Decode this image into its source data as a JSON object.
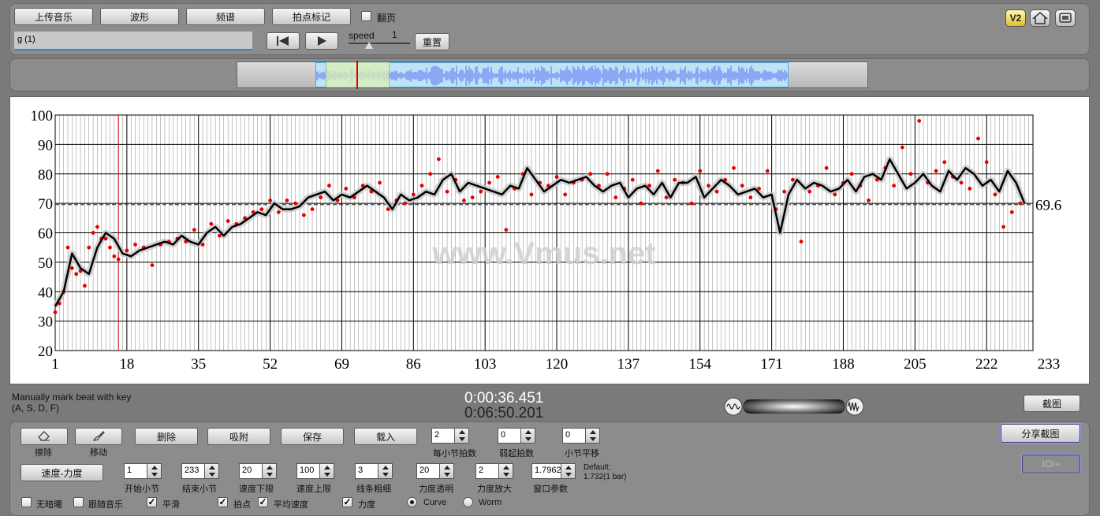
{
  "top": {
    "upload_label": "上传音乐",
    "wave_label": "波形",
    "spectrum_label": "频谱",
    "beat_mark_label": "拍点标记",
    "flip_label": "翻页",
    "file_name": "g (1)",
    "speed_label": "speed",
    "speed_value": "1",
    "reset_label": "重置",
    "version_badge": "V2",
    "home_icon": "home-icon",
    "window_icon": "window-icon"
  },
  "chart_data": {
    "type": "line",
    "watermark": "www.Vmus.net",
    "ylim": [
      20,
      100
    ],
    "yticks": [
      20,
      30,
      40,
      50,
      60,
      70,
      80,
      90,
      100
    ],
    "xlim": [
      1,
      233
    ],
    "xticks": [
      1,
      18,
      35,
      52,
      69,
      86,
      103,
      120,
      137,
      154,
      171,
      188,
      205,
      222,
      233
    ],
    "mean": 69.6,
    "mean_label": "69.6",
    "cursor_x": 16,
    "smooth_series": {
      "color": "#000000",
      "x": [
        1,
        3,
        5,
        7,
        9,
        11,
        13,
        15,
        17,
        19,
        21,
        23,
        25,
        27,
        29,
        31,
        33,
        35,
        37,
        39,
        41,
        43,
        45,
        47,
        49,
        51,
        53,
        55,
        57,
        59,
        61,
        63,
        65,
        67,
        69,
        71,
        73,
        75,
        77,
        79,
        81,
        83,
        85,
        87,
        89,
        91,
        93,
        95,
        97,
        99,
        101,
        103,
        105,
        107,
        109,
        111,
        113,
        115,
        117,
        119,
        121,
        123,
        125,
        127,
        129,
        131,
        133,
        135,
        137,
        139,
        141,
        143,
        145,
        147,
        149,
        151,
        153,
        155,
        157,
        159,
        161,
        163,
        165,
        167,
        169,
        171,
        173,
        175,
        177,
        179,
        181,
        183,
        185,
        187,
        189,
        191,
        193,
        195,
        197,
        199,
        201,
        203,
        205,
        207,
        209,
        211,
        213,
        215,
        217,
        219,
        221,
        223,
        225,
        227,
        229,
        231
      ],
      "y": [
        35,
        40,
        53,
        48,
        46,
        55,
        60,
        58,
        53,
        52,
        54,
        55,
        56,
        57,
        56,
        59,
        57,
        56,
        60,
        62,
        59,
        62,
        63,
        65,
        67,
        66,
        70,
        68,
        68,
        69,
        72,
        73,
        74,
        71,
        73,
        72,
        74,
        76,
        74,
        72,
        68,
        73,
        71,
        72,
        74,
        73,
        78,
        80,
        74,
        77,
        76,
        75,
        74,
        73,
        76,
        75,
        82,
        78,
        74,
        76,
        78,
        77,
        78,
        79,
        76,
        74,
        76,
        77,
        72,
        75,
        76,
        73,
        77,
        72,
        77,
        77,
        79,
        72,
        75,
        78,
        76,
        73,
        74,
        75,
        72,
        73,
        60,
        73,
        78,
        75,
        77,
        76,
        74,
        75,
        78,
        74,
        79,
        80,
        78,
        85,
        80,
        75,
        77,
        80,
        76,
        74,
        81,
        78,
        82,
        80,
        76,
        78,
        74,
        81,
        77,
        70,
        63,
        72
      ]
    },
    "scatter_series": {
      "color": "#e60000",
      "x": [
        1,
        2,
        3,
        4,
        5,
        6,
        7,
        8,
        9,
        10,
        11,
        12,
        13,
        14,
        15,
        16,
        18,
        20,
        22,
        24,
        26,
        28,
        30,
        32,
        34,
        36,
        38,
        40,
        42,
        44,
        46,
        48,
        50,
        52,
        54,
        56,
        58,
        60,
        62,
        64,
        66,
        68,
        70,
        72,
        74,
        76,
        78,
        80,
        82,
        84,
        86,
        88,
        90,
        92,
        94,
        96,
        98,
        100,
        102,
        104,
        106,
        108,
        110,
        112,
        114,
        116,
        118,
        120,
        122,
        124,
        126,
        128,
        130,
        132,
        134,
        136,
        138,
        140,
        142,
        144,
        146,
        148,
        150,
        152,
        154,
        156,
        158,
        160,
        162,
        164,
        166,
        168,
        170,
        172,
        174,
        176,
        178,
        180,
        182,
        184,
        186,
        188,
        190,
        192,
        194,
        196,
        198,
        200,
        202,
        204,
        206,
        208,
        210,
        212,
        214,
        216,
        218,
        220,
        222,
        224,
        226,
        228,
        230
      ],
      "y": [
        33,
        36,
        40,
        55,
        48,
        46,
        47,
        42,
        55,
        60,
        62,
        58,
        58,
        55,
        52,
        51,
        54,
        56,
        55,
        49,
        56,
        57,
        58,
        57,
        61,
        56,
        63,
        59,
        64,
        63,
        65,
        67,
        68,
        71,
        67,
        71,
        70,
        66,
        68,
        72,
        76,
        71,
        75,
        72,
        76,
        74,
        77,
        68,
        71,
        70,
        73,
        76,
        80,
        85,
        74,
        78,
        71,
        72,
        74,
        77,
        79,
        61,
        75,
        80,
        73,
        77,
        76,
        79,
        73,
        77,
        78,
        80,
        76,
        80,
        72,
        75,
        78,
        70,
        76,
        81,
        72,
        78,
        77,
        70,
        81,
        76,
        74,
        78,
        82,
        76,
        72,
        75,
        81,
        68,
        74,
        78,
        57,
        74,
        76,
        82,
        73,
        77,
        80,
        76,
        71,
        78,
        82,
        76,
        89,
        80,
        98,
        77,
        81,
        84,
        79,
        77,
        75,
        92,
        84,
        73,
        62,
        67,
        70
      ]
    }
  },
  "transport": {
    "status_line1": "Manually mark beat with key",
    "status_line2": "(A, S, D, F)",
    "time_current": "0:00:36.451",
    "time_total": "0:06:50.201",
    "screenshot_label": "截图"
  },
  "controls": {
    "erase_label": "擦除",
    "move_label": "移动",
    "delete_label": "删除",
    "snap_label": "吸附",
    "save_label": "保存",
    "load_label": "载入",
    "beats_per_bar_value": "2",
    "beats_per_bar_label": "每小节拍数",
    "weak_beats_value": "0",
    "weak_beats_label": "弱起拍数",
    "bar_shift_value": "0",
    "bar_shift_label": "小节平移",
    "share_label": "分享截图",
    "ioi_label": "IOI+",
    "tempo_dynamics_label": "速度-力度",
    "start_bar_value": "1",
    "start_bar_label": "开始小节",
    "end_bar_value": "233",
    "end_bar_label": "结束小节",
    "tempo_low_value": "20",
    "tempo_low_label": "速度下限",
    "tempo_high_value": "100",
    "tempo_high_label": "速度上限",
    "line_width_value": "3",
    "line_width_label": "线条粗细",
    "dyn_alpha_value": "20",
    "dyn_alpha_label": "力度透明",
    "dyn_scale_value": "2",
    "dyn_scale_label": "力度放大",
    "window_value": "1.7962",
    "window_label": "窗口参数",
    "default_line1": "Default:",
    "default_line2": "1.732(1 bar)",
    "no_reverse_label": "无暗曙",
    "follow_music_label": "跟随音乐",
    "smooth_label": "平滑",
    "beat_point_label": "拍点",
    "avg_tempo_label": "平均速度",
    "dynamics_label": "力度",
    "curve_label": "Curve",
    "worm_label": "Worm"
  }
}
